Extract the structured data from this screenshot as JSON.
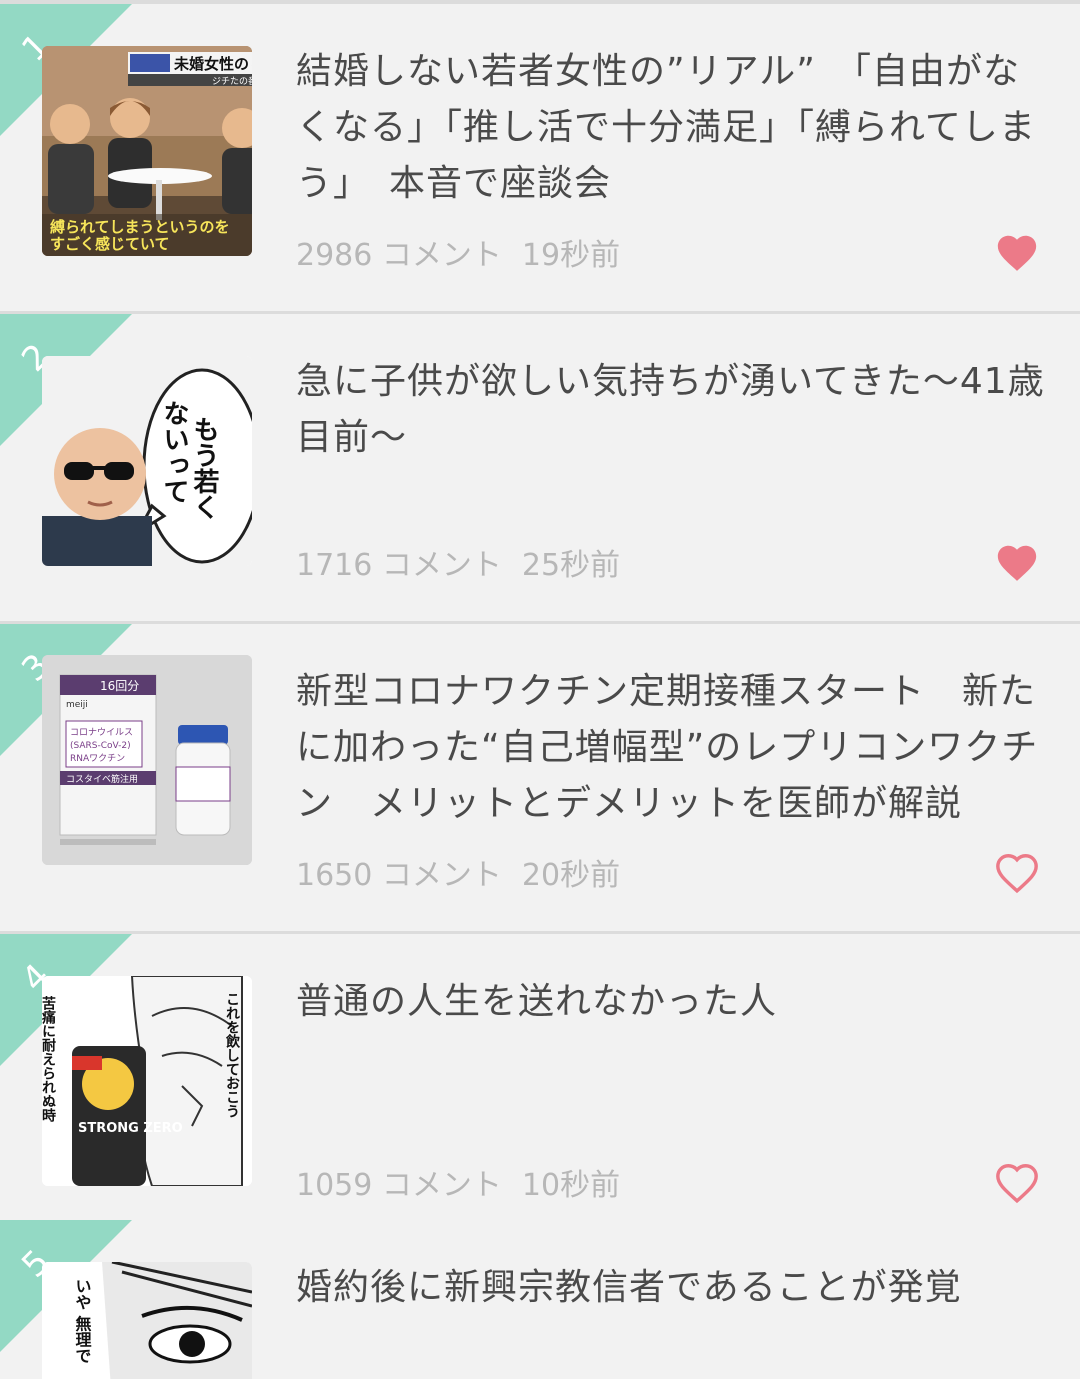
{
  "colors": {
    "ribbon": "#93d9c4",
    "heart": "#ec7a88",
    "meta_text": "#b7b7b7",
    "title_text": "#4a4a4a"
  },
  "items": [
    {
      "rank": "1",
      "title": "結婚しない若者女性の”リアル”　「自由がなくなる」「推し活で十分満足」「縛られてしまう」　本音で座談会",
      "comments": "2986 コメント",
      "time": "19秒前",
      "liked": true,
      "thumb_icon": "tv-roundtable-image",
      "thumb_text": {
        "banner": "未婚女性のリ",
        "sub": "ジチたの番",
        "caption_line1": "縛られてしまうというのを",
        "caption_line2": "すごく感じていて"
      }
    },
    {
      "rank": "2",
      "title": "急に子供が欲しい気持ちが湧いてきた〜41歳目前〜",
      "comments": "1716 コメント",
      "time": "25秒前",
      "liked": true,
      "thumb_icon": "baby-sunglasses-image",
      "thumb_text": {
        "bubble_line1": "もう若く",
        "bubble_line2": "ないって"
      }
    },
    {
      "rank": "3",
      "title": "新型コロナワクチン定期接種スタート　新たに加わった“自己増幅型”のレプリコンワクチン　メリットとデメリットを医師が解説",
      "comments": "1650 コメント",
      "time": "20秒前",
      "liked": false,
      "thumb_icon": "vaccine-box-image",
      "thumb_text": {
        "box_top": "16回分",
        "box_name1": "コロナウイルス",
        "box_name2": "(SARS-CoV-2)",
        "box_name3": "RNAワクチン",
        "box_brand": "コスタイベ筋注用",
        "brand": "meiji"
      }
    },
    {
      "rank": "4",
      "title": "普通の人生を送れなかった人",
      "comments": "1059 コメント",
      "time": "10秒前",
      "liked": false,
      "thumb_icon": "manga-strong-zero-image",
      "thumb_text": {
        "left": "苦痛に耐えられぬ時",
        "right": "これを飲しておこう",
        "can": "STRONG ZERO"
      }
    },
    {
      "rank": "5",
      "title": "婚約後に新興宗教信者であることが発覚",
      "comments": "",
      "time": "",
      "liked": false,
      "thumb_icon": "manga-face-image",
      "thumb_text": {
        "speech": "いや 無理で"
      }
    }
  ]
}
